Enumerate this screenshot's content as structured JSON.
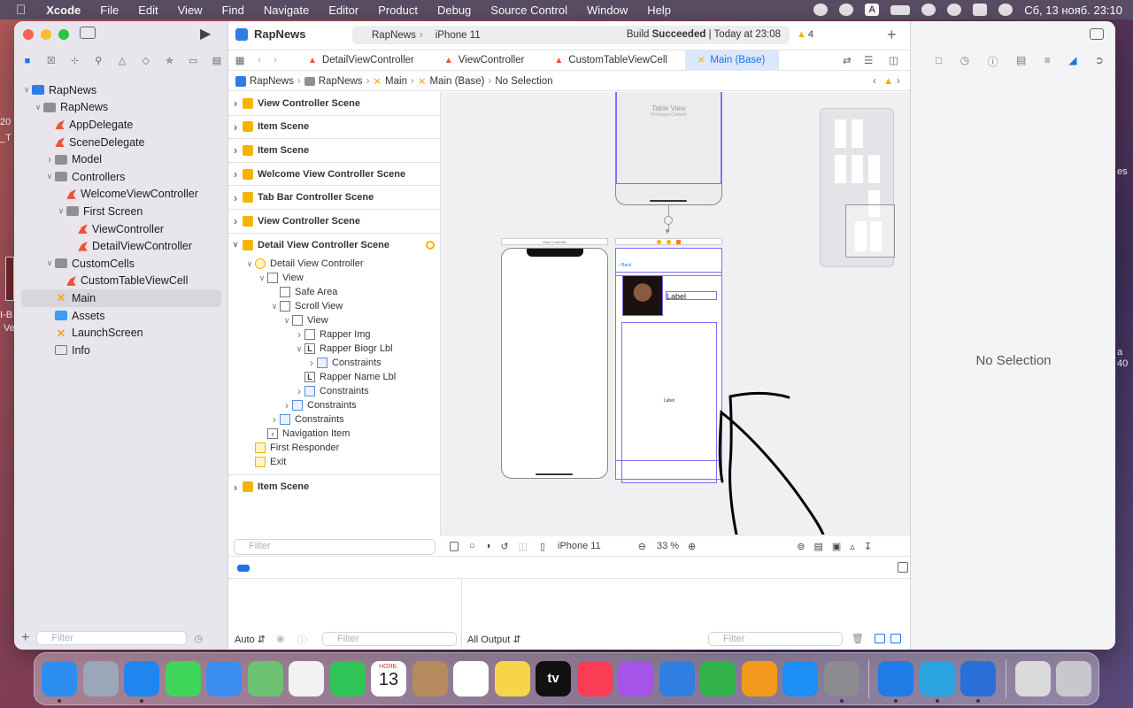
{
  "menubar": {
    "app": "Xcode",
    "items": [
      "File",
      "Edit",
      "View",
      "Find",
      "Navigate",
      "Editor",
      "Product",
      "Debug",
      "Source Control",
      "Window",
      "Help"
    ],
    "input_source": "A",
    "datetime": "Сб, 13 нояб.  23:10"
  },
  "toolbar": {
    "project_name": "RapNews",
    "scheme": "RapNews",
    "device": "iPhone 11",
    "build_status_prefix": "Build",
    "build_status_bold": "Succeeded",
    "build_status_time": "| Today at 23:08",
    "warnings": "4"
  },
  "navigator": {
    "items": [
      {
        "label": "RapNews",
        "icon": "project-icon",
        "depth": 0,
        "disclosure": "open"
      },
      {
        "label": "RapNews",
        "icon": "folder-icon",
        "depth": 1,
        "disclosure": "open"
      },
      {
        "label": "AppDelegate",
        "icon": "swift-file-icon",
        "depth": 2,
        "disclosure": ""
      },
      {
        "label": "SceneDelegate",
        "icon": "swift-file-icon",
        "depth": 2,
        "disclosure": ""
      },
      {
        "label": "Model",
        "icon": "folder-icon",
        "depth": 2,
        "disclosure": "closed"
      },
      {
        "label": "Controllers",
        "icon": "folder-icon",
        "depth": 2,
        "disclosure": "open"
      },
      {
        "label": "WelcomeViewController",
        "icon": "swift-file-icon",
        "depth": 3,
        "disclosure": ""
      },
      {
        "label": "First Screen",
        "icon": "folder-icon",
        "depth": 3,
        "disclosure": "open"
      },
      {
        "label": "ViewController",
        "icon": "swift-file-icon",
        "depth": 4,
        "disclosure": ""
      },
      {
        "label": "DetailViewController",
        "icon": "swift-file-icon",
        "depth": 4,
        "disclosure": ""
      },
      {
        "label": "CustomCells",
        "icon": "folder-icon",
        "depth": 2,
        "disclosure": "open"
      },
      {
        "label": "CustomTableViewCell",
        "icon": "swift-file-icon",
        "depth": 3,
        "disclosure": ""
      },
      {
        "label": "Main",
        "icon": "storyboard-icon",
        "depth": 2,
        "disclosure": "",
        "selected": true
      },
      {
        "label": "Assets",
        "icon": "assets-icon",
        "depth": 2,
        "disclosure": ""
      },
      {
        "label": "LaunchScreen",
        "icon": "storyboard-icon",
        "depth": 2,
        "disclosure": ""
      },
      {
        "label": "Info",
        "icon": "plist-icon",
        "depth": 2,
        "disclosure": ""
      }
    ],
    "filter_placeholder": "Filter"
  },
  "tabs": [
    {
      "label": "DetailViewController",
      "active": false
    },
    {
      "label": "ViewController",
      "active": false
    },
    {
      "label": "CustomTableViewCell",
      "active": false
    },
    {
      "label": "Main (Base)",
      "active": true
    }
  ],
  "jumpbar": [
    "RapNews",
    "RapNews",
    "Main",
    "Main (Base)",
    "No Selection"
  ],
  "outline": {
    "scenes_top": [
      "View Controller Scene",
      "Item Scene",
      "Item Scene",
      "Welcome View Controller Scene",
      "Tab Bar Controller Scene",
      "View Controller Scene",
      "Detail View Controller Scene"
    ],
    "detail_items": [
      {
        "label": "Detail View Controller",
        "depth": 1,
        "disclosure": "open",
        "icon": "y"
      },
      {
        "label": "View",
        "depth": 2,
        "disclosure": "open",
        "icon": "v"
      },
      {
        "label": "Safe Area",
        "depth": 3,
        "disclosure": "",
        "icon": "v"
      },
      {
        "label": "Scroll View",
        "depth": 3,
        "disclosure": "open",
        "icon": "v"
      },
      {
        "label": "View",
        "depth": 4,
        "disclosure": "open",
        "icon": "v"
      },
      {
        "label": "Rapper Img",
        "depth": 5,
        "disclosure": "closed",
        "icon": "img"
      },
      {
        "label": "Rapper Biogr Lbl",
        "depth": 5,
        "disclosure": "open",
        "icon": "L"
      },
      {
        "label": "Constraints",
        "depth": 6,
        "disclosure": "closed",
        "icon": "c"
      },
      {
        "label": "Rapper Name Lbl",
        "depth": 5,
        "disclosure": "",
        "icon": "L"
      },
      {
        "label": "Constraints",
        "depth": 5,
        "disclosure": "closed",
        "icon": "c"
      },
      {
        "label": "Constraints",
        "depth": 4,
        "disclosure": "closed",
        "icon": "c"
      },
      {
        "label": "Constraints",
        "depth": 3,
        "disclosure": "closed",
        "icon": "c"
      },
      {
        "label": "Navigation Item",
        "depth": 2,
        "disclosure": "",
        "icon": "nav"
      },
      {
        "label": "First Responder",
        "depth": 1,
        "disclosure": "",
        "icon": "fr"
      },
      {
        "label": "Exit",
        "depth": 1,
        "disclosure": "",
        "icon": "exit"
      }
    ],
    "scene_bottom": "Item Scene",
    "filter_placeholder": "Filter"
  },
  "canvas": {
    "table_view_title": "Table View",
    "table_view_sub": "Prototype Content",
    "vc_title": "View Controller",
    "back_label": "Back",
    "label_text": "Label",
    "bio_label": "Label",
    "device": "iPhone 11",
    "zoom": "33 %"
  },
  "debug": {
    "auto_label": "Auto",
    "filter_placeholder": "Filter",
    "output_label": "All Output",
    "output_filter_placeholder": "Filter"
  },
  "inspector": {
    "empty_text": "No Selection"
  },
  "desktop_edge": {
    "left_1": "20",
    "left_2": "_T",
    "left_3": "I-B",
    "left_4": "Ve",
    "right_1": "es",
    "right_2": "a",
    "right_3": "40"
  },
  "dock": {
    "apps": [
      {
        "name": "Finder",
        "color": "#2c8ff0",
        "running": true
      },
      {
        "name": "Launchpad",
        "color": "#9aa7b8",
        "running": false
      },
      {
        "name": "Safari",
        "color": "#1f86f0",
        "running": true
      },
      {
        "name": "Messages",
        "color": "#3fd65a",
        "running": false
      },
      {
        "name": "Mail",
        "color": "#3b8df2",
        "running": false
      },
      {
        "name": "Maps",
        "color": "#6cc270",
        "running": false
      },
      {
        "name": "Photos",
        "color": "#f2f2f2",
        "running": false
      },
      {
        "name": "FaceTime",
        "color": "#2fc455",
        "running": false
      },
      {
        "name": "Calendar",
        "color": "#ffffff",
        "running": false
      },
      {
        "name": "Contacts",
        "color": "#b58a5c",
        "running": false
      },
      {
        "name": "Reminders",
        "color": "#ffffff",
        "running": false
      },
      {
        "name": "Notes",
        "color": "#f7d54a",
        "running": false
      },
      {
        "name": "TV",
        "color": "#111111",
        "running": false
      },
      {
        "name": "Music",
        "color": "#fa3c55",
        "running": false
      },
      {
        "name": "Podcasts",
        "color": "#a653e8",
        "running": false
      },
      {
        "name": "Keynote",
        "color": "#2f7fe3",
        "running": false
      },
      {
        "name": "Numbers",
        "color": "#31b34a",
        "running": false
      },
      {
        "name": "Pages",
        "color": "#f39a1e",
        "running": false
      },
      {
        "name": "App Store",
        "color": "#1d8ef5",
        "running": false
      },
      {
        "name": "System Preferences",
        "color": "#8b8b90",
        "running": true
      },
      {
        "name": "Xcode",
        "color": "#1f7be6",
        "running": true
      },
      {
        "name": "Telegram",
        "color": "#2aa3e0",
        "running": true
      },
      {
        "name": "Instruments",
        "color": "#2a6fd8",
        "running": true
      },
      {
        "name": "Downloads",
        "color": "#dadada",
        "running": false
      },
      {
        "name": "Trash",
        "color": "#c8c8cc",
        "running": false
      }
    ],
    "calendar_month": "НОЯБ.",
    "calendar_day": "13",
    "tv_label": "tv"
  }
}
